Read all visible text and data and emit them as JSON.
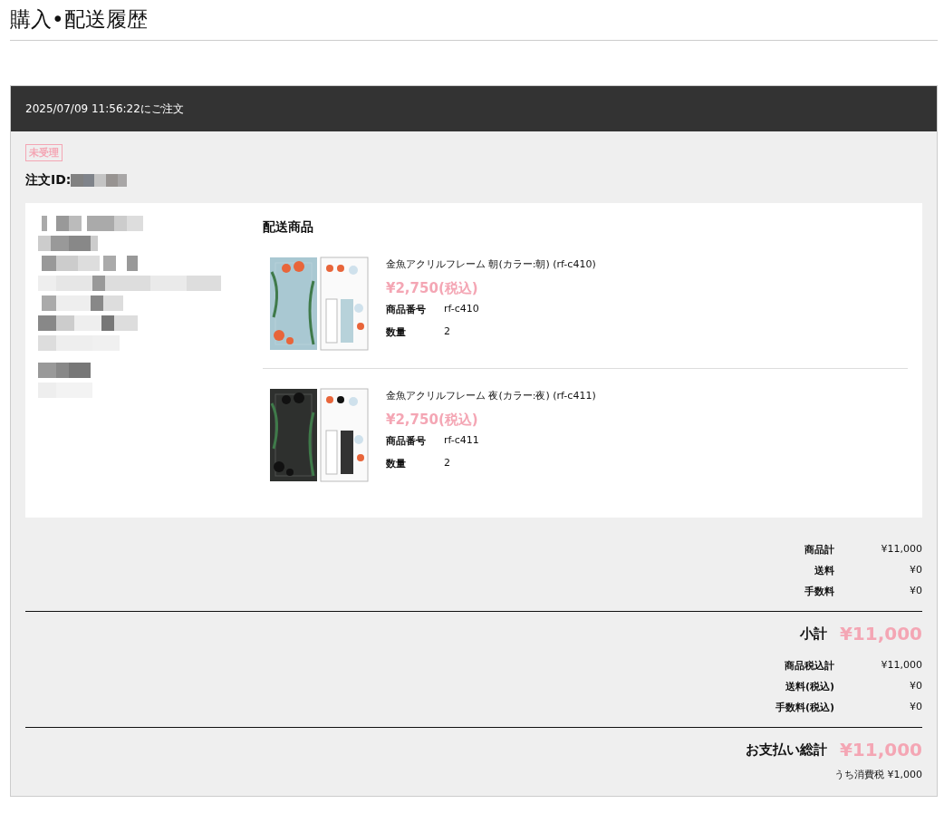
{
  "page_title": "購入•配送履歴",
  "order": {
    "ordered_at": "2025/07/09 11:56:22にご注文",
    "status": "未受理",
    "id_label": "注文ID:",
    "shipping": {
      "heading": "配送商品",
      "items": [
        {
          "name": "金魚アクリルフレーム 朝(カラー:朝) (rf-c410)",
          "price": "¥2,750(税込)",
          "fields": [
            {
              "label": "商品番号",
              "value": "rf-c410"
            },
            {
              "label": "数量",
              "value": "2"
            }
          ]
        },
        {
          "name": "金魚アクリルフレーム 夜(カラー:夜) (rf-c411)",
          "price": "¥2,750(税込)",
          "fields": [
            {
              "label": "商品番号",
              "value": "rf-c411"
            },
            {
              "label": "数量",
              "value": "2"
            }
          ]
        }
      ]
    },
    "totals": {
      "rows": [
        {
          "label": "商品計",
          "value": "¥11,000"
        },
        {
          "label": "送料",
          "value": "¥0"
        },
        {
          "label": "手数料",
          "value": "¥0"
        }
      ],
      "subtotal": {
        "label": "小計",
        "value": "¥11,000"
      },
      "tax_rows": [
        {
          "label": "商品税込計",
          "value": "¥11,000"
        },
        {
          "label": "送料(税込)",
          "value": "¥0"
        },
        {
          "label": "手数料(税込)",
          "value": "¥0"
        }
      ],
      "grand_total": {
        "label": "お支払い総計",
        "value": "¥11,000"
      },
      "tax_note": "うち消費税  ¥1,000"
    }
  }
}
